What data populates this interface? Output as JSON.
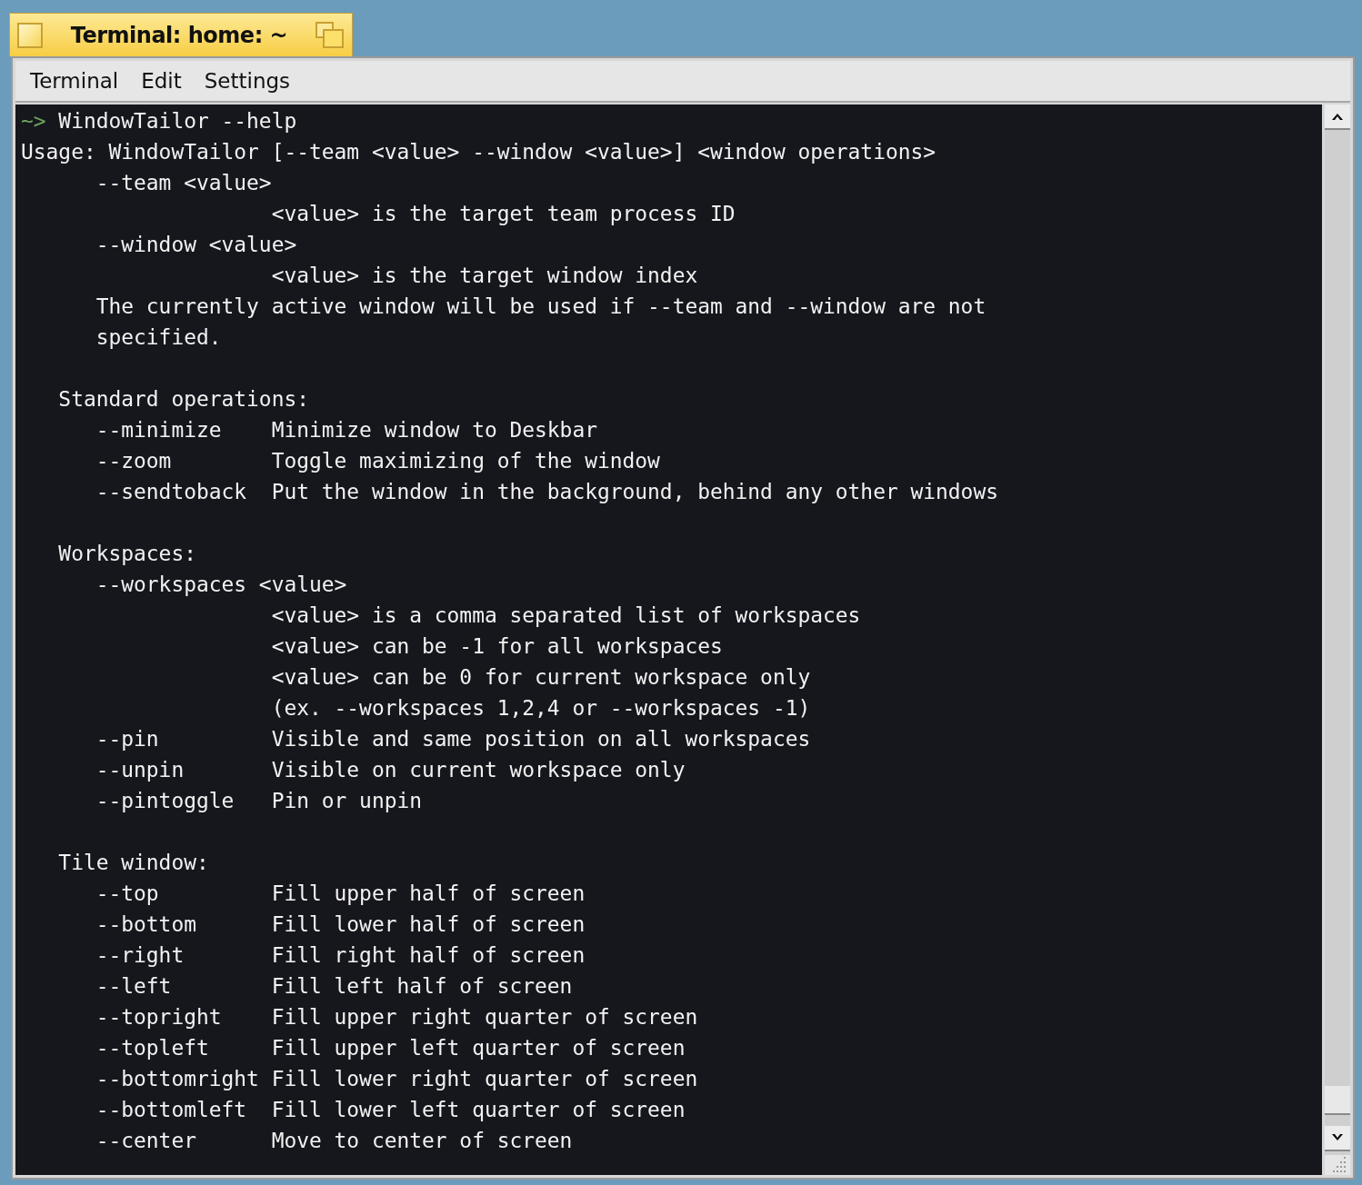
{
  "window": {
    "title": "Terminal: home: ~"
  },
  "menu": [
    "Terminal",
    "Edit",
    "Settings"
  ],
  "terminal": {
    "lines": [
      {
        "kind": "prompt",
        "prompt": "~>",
        "text": " WindowTailor --help"
      },
      {
        "kind": "text",
        "text": "Usage: WindowTailor [--team <value> --window <value>] <window operations>"
      },
      {
        "kind": "text",
        "text": "      --team <value>"
      },
      {
        "kind": "text",
        "text": "                    <value> is the target team process ID"
      },
      {
        "kind": "text",
        "text": "      --window <value>"
      },
      {
        "kind": "text",
        "text": "                    <value> is the target window index"
      },
      {
        "kind": "text",
        "text": "      The currently active window will be used if --team and --window are not"
      },
      {
        "kind": "text",
        "text": "      specified."
      },
      {
        "kind": "blank"
      },
      {
        "kind": "text",
        "text": "   Standard operations:"
      },
      {
        "kind": "text",
        "text": "      --minimize    Minimize window to Deskbar"
      },
      {
        "kind": "text",
        "text": "      --zoom        Toggle maximizing of the window"
      },
      {
        "kind": "text",
        "text": "      --sendtoback  Put the window in the background, behind any other windows"
      },
      {
        "kind": "blank"
      },
      {
        "kind": "text",
        "text": "   Workspaces:"
      },
      {
        "kind": "text",
        "text": "      --workspaces <value>"
      },
      {
        "kind": "text",
        "text": "                    <value> is a comma separated list of workspaces"
      },
      {
        "kind": "text",
        "text": "                    <value> can be -1 for all workspaces"
      },
      {
        "kind": "text",
        "text": "                    <value> can be 0 for current workspace only"
      },
      {
        "kind": "text",
        "text": "                    (ex. --workspaces 1,2,4 or --workspaces -1)"
      },
      {
        "kind": "text",
        "text": "      --pin         Visible and same position on all workspaces"
      },
      {
        "kind": "text",
        "text": "      --unpin       Visible on current workspace only"
      },
      {
        "kind": "text",
        "text": "      --pintoggle   Pin or unpin"
      },
      {
        "kind": "blank"
      },
      {
        "kind": "text",
        "text": "   Tile window:"
      },
      {
        "kind": "text",
        "text": "      --top         Fill upper half of screen"
      },
      {
        "kind": "text",
        "text": "      --bottom      Fill lower half of screen"
      },
      {
        "kind": "text",
        "text": "      --right       Fill right half of screen"
      },
      {
        "kind": "text",
        "text": "      --left        Fill left half of screen"
      },
      {
        "kind": "text",
        "text": "      --topright    Fill upper right quarter of screen"
      },
      {
        "kind": "text",
        "text": "      --topleft     Fill upper left quarter of screen"
      },
      {
        "kind": "text",
        "text": "      --bottomright Fill lower right quarter of screen"
      },
      {
        "kind": "text",
        "text": "      --bottomleft  Fill lower left quarter of screen"
      },
      {
        "kind": "text",
        "text": "      --center      Move to center of screen"
      }
    ]
  }
}
